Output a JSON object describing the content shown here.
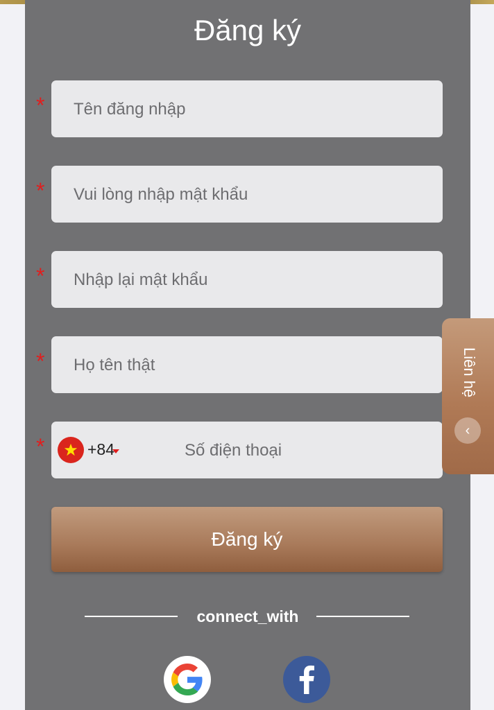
{
  "form": {
    "title": "Đăng ký",
    "required_mark": "*",
    "username_placeholder": "Tên đăng nhập",
    "password_placeholder": "Vui lòng nhập mật khẩu",
    "confirm_password_placeholder": "Nhập lại mật khẩu",
    "fullname_placeholder": "Họ tên thật",
    "phone": {
      "country_flag": "vietnam-flag",
      "dial_code": "+84",
      "placeholder": "Số điện thoại"
    },
    "submit_label": "Đăng ký"
  },
  "social": {
    "divider_label": "connect_with",
    "providers": [
      "google",
      "facebook"
    ]
  },
  "contact_tab": {
    "label": "Liên hệ",
    "icon": "chevron-left-icon"
  },
  "colors": {
    "panel": "#717173",
    "field": "#e9e9eb",
    "accent": "#b07a56",
    "required": "#e01e1e",
    "facebook": "#3c5a99"
  }
}
